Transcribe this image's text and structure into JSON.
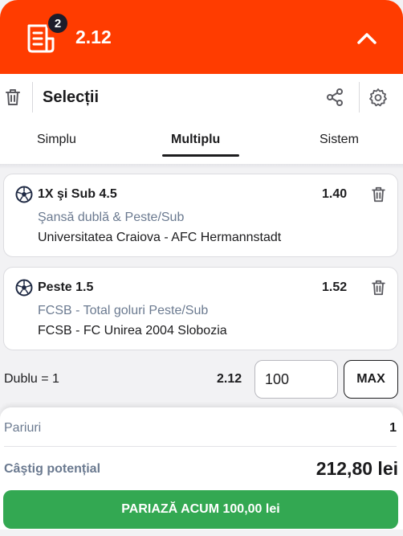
{
  "header": {
    "selection_count": "2",
    "total_odds": "2.12",
    "icons": {
      "slip": "bet-slip-icon",
      "collapse": "chevron-up-icon"
    },
    "colors": {
      "background": "#ff3c00",
      "badge": "#1d1d2b"
    }
  },
  "toolbar": {
    "title": "Selecții",
    "icons": {
      "delete_all": "trash-icon",
      "share": "share-icon",
      "settings": "gear-icon"
    }
  },
  "tabs": [
    {
      "label": "Simplu",
      "active": false
    },
    {
      "label": "Multiplu",
      "active": true
    },
    {
      "label": "Sistem",
      "active": false
    }
  ],
  "selections": [
    {
      "name": "1X şi Sub 4.5",
      "odds": "1.40",
      "market": "Şansă dublă & Peste/Sub",
      "event": "Universitatea Craiova - AFC Hermannstadt",
      "sport_icon": "football-icon"
    },
    {
      "name": "Peste 1.5",
      "odds": "1.52",
      "market": "FCSB - Total goluri Peste/Sub",
      "event": "FCSB - FC Unirea 2004 Slobozia",
      "sport_icon": "football-icon"
    }
  ],
  "stake": {
    "label": "Dublu = 1",
    "odds": "2.12",
    "value": "100",
    "max_label": "MAX"
  },
  "summary": {
    "bets_label": "Pariuri",
    "bets_value": "1",
    "win_label": "Câştig potențial",
    "win_value": "212,80 lei",
    "place_bet_label": "PARIAZĂ ACUM 100,00 lei",
    "colors": {
      "place_bet": "#33a852"
    }
  }
}
